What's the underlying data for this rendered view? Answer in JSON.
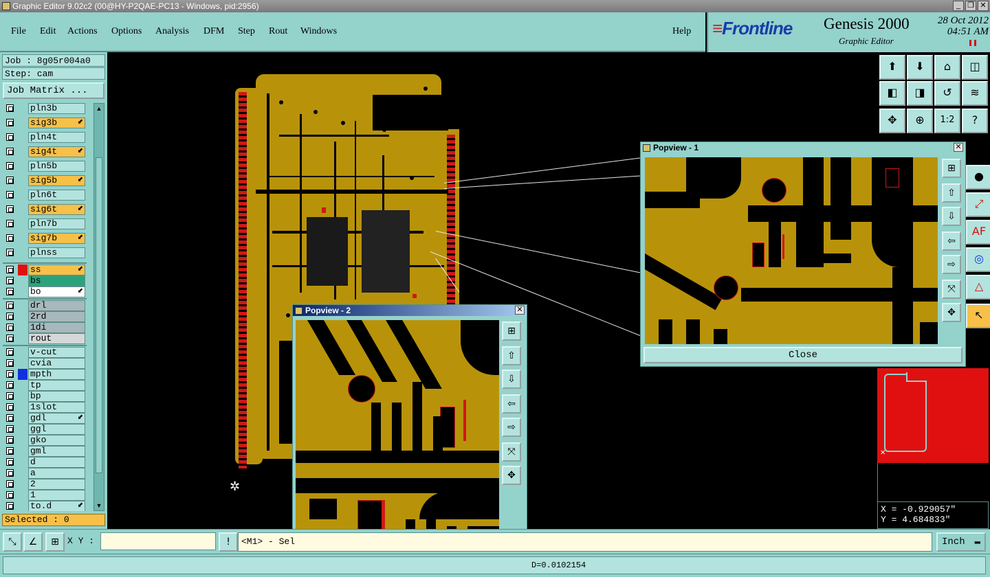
{
  "window": {
    "title": "Graphic Editor 9.02c2 (00@HY-P2QAE-PC13 - Windows, pid:2956)",
    "controls": [
      "_",
      "❐",
      "✕"
    ]
  },
  "menu": [
    "File",
    "Edit",
    "Actions",
    "Options",
    "Analysis",
    "DFM",
    "Step",
    "Rout",
    "Windows"
  ],
  "help": "Help",
  "brand": {
    "logo": "Frontline",
    "product": "Genesis 2000",
    "subtitle": "Graphic Editor",
    "date": "28 Oct 2012",
    "time": "04:51 AM"
  },
  "job": "Job : 8g05r004a0",
  "step": "Step: cam",
  "job_matrix": "Job Matrix ...",
  "layers": [
    {
      "name": "pln3b",
      "color": "",
      "style": "cyan",
      "icon": ""
    },
    {
      "name": "sig3b",
      "color": "",
      "style": "orange",
      "icon": "⬋"
    },
    {
      "name": "pln4t",
      "color": "",
      "style": "cyan",
      "icon": ""
    },
    {
      "name": "sig4t",
      "color": "",
      "style": "orange",
      "icon": "⬋"
    },
    {
      "name": "pln5b",
      "color": "",
      "style": "cyan",
      "icon": ""
    },
    {
      "name": "sig5b",
      "color": "",
      "style": "orange",
      "icon": "⬋"
    },
    {
      "name": "pln6t",
      "color": "",
      "style": "cyan",
      "icon": ""
    },
    {
      "name": "sig6t",
      "color": "",
      "style": "orange",
      "icon": "⬋"
    },
    {
      "name": "pln7b",
      "color": "",
      "style": "cyan",
      "icon": ""
    },
    {
      "name": "sig7b",
      "color": "",
      "style": "orange",
      "icon": "⬋"
    },
    {
      "name": "plnss",
      "color": "",
      "style": "cyan",
      "icon": ""
    },
    {
      "name": "ss",
      "color": "#e01010",
      "style": "orange",
      "icon": "⬋"
    },
    {
      "name": "bs",
      "color": "",
      "style": "green",
      "icon": ""
    },
    {
      "name": "bo",
      "color": "",
      "style": "white",
      "icon": "⬋"
    },
    {
      "name": "drl",
      "color": "",
      "style": "gray",
      "icon": ""
    },
    {
      "name": "2rd",
      "color": "",
      "style": "gray",
      "icon": ""
    },
    {
      "name": "1di",
      "color": "",
      "style": "gray",
      "icon": ""
    },
    {
      "name": "rout",
      "color": "",
      "style": "lightgray",
      "icon": ""
    },
    {
      "name": "v-cut",
      "color": "",
      "style": "cyan",
      "icon": ""
    },
    {
      "name": "cvia",
      "color": "",
      "style": "cyan",
      "icon": ""
    },
    {
      "name": "mpth",
      "color": "#1030e0",
      "style": "cyan",
      "icon": ""
    },
    {
      "name": "tp",
      "color": "",
      "style": "cyan",
      "icon": ""
    },
    {
      "name": "bp",
      "color": "",
      "style": "cyan",
      "icon": ""
    },
    {
      "name": "1slot",
      "color": "",
      "style": "cyan",
      "icon": ""
    },
    {
      "name": "gdl",
      "color": "",
      "style": "cyan",
      "icon": "⬋"
    },
    {
      "name": "ggl",
      "color": "",
      "style": "cyan",
      "icon": ""
    },
    {
      "name": "gko",
      "color": "",
      "style": "cyan",
      "icon": ""
    },
    {
      "name": "gml",
      "color": "",
      "style": "cyan",
      "icon": ""
    },
    {
      "name": "d",
      "color": "",
      "style": "cyan",
      "icon": ""
    },
    {
      "name": "a",
      "color": "",
      "style": "cyan",
      "icon": ""
    },
    {
      "name": "2",
      "color": "",
      "style": "cyan",
      "icon": ""
    },
    {
      "name": "1",
      "color": "",
      "style": "cyan",
      "icon": ""
    },
    {
      "name": "to.d",
      "color": "",
      "style": "cyan",
      "icon": "⬋"
    }
  ],
  "selected": "Selected : 0",
  "popview1": {
    "title": "Popview - 1",
    "close": "Close"
  },
  "popview2": {
    "title": "Popview - 2"
  },
  "right_tools": [
    "⬆",
    "⬇",
    "⌂",
    "◫",
    "◧",
    "◨",
    "↺",
    "≋",
    "✥",
    "⊕",
    "1:2",
    "?"
  ],
  "coords": {
    "x": "X = -0.929057\"",
    "y": "Y = 4.684833\""
  },
  "bottom": {
    "xy_label": "X Y :",
    "xy_value": "",
    "message": "<M1> - Sel",
    "units": "Inch",
    "status": "D=0.0102154"
  },
  "colors": {
    "copper": "#b8930a",
    "panel": "#94d2cc",
    "highlight": "#f7c048"
  }
}
